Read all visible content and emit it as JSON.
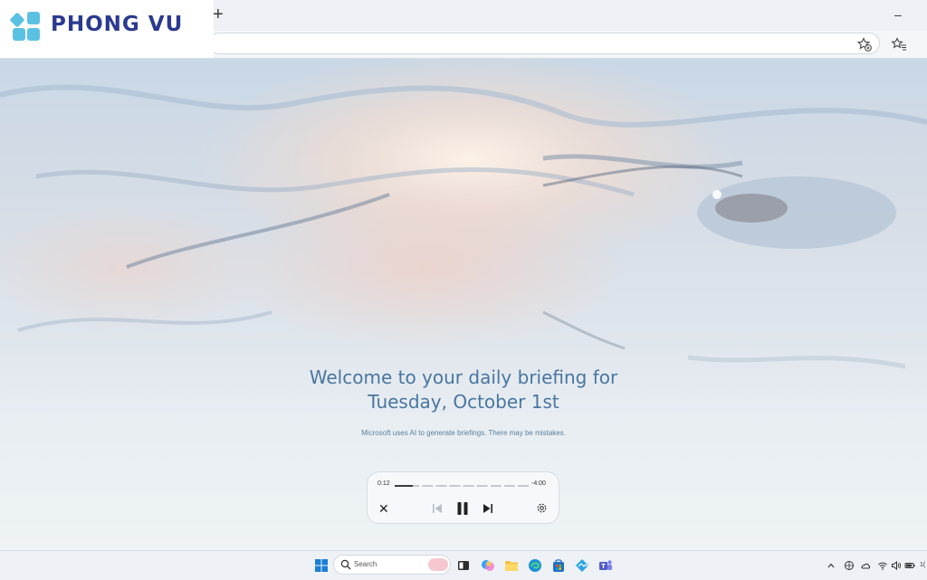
{
  "logo": {
    "text": "PHONG VU"
  },
  "browser": {
    "new_tab_label": "+",
    "minimize_label": "–",
    "address": ""
  },
  "briefing": {
    "title_line1": "Welcome to your daily briefing for",
    "title_line2": "Tuesday, October 1st",
    "disclaimer": "Microsoft uses AI to generate briefings. There may be mistakes."
  },
  "player": {
    "elapsed": "0:12",
    "remaining": "-4:00",
    "progress": 0.05,
    "segments": 10,
    "close_glyph": "✕"
  },
  "taskbar": {
    "search_placeholder": "Search",
    "apps": [
      "start-icon",
      "search-input",
      "task-view-icon",
      "copilot-icon",
      "file-explorer-icon",
      "edge-icon",
      "store-icon",
      "photos-icon",
      "teams-icon"
    ],
    "tray": [
      "chevron-up-icon",
      "network-icon",
      "cloud-icon",
      "wifi-icon",
      "volume-icon",
      "battery-icon"
    ],
    "clock": "1("
  },
  "colors": {
    "accent_text": "#4a76a0",
    "logo_blue": "#2b3a8f",
    "logo_cyan": "#5bc1e3"
  }
}
